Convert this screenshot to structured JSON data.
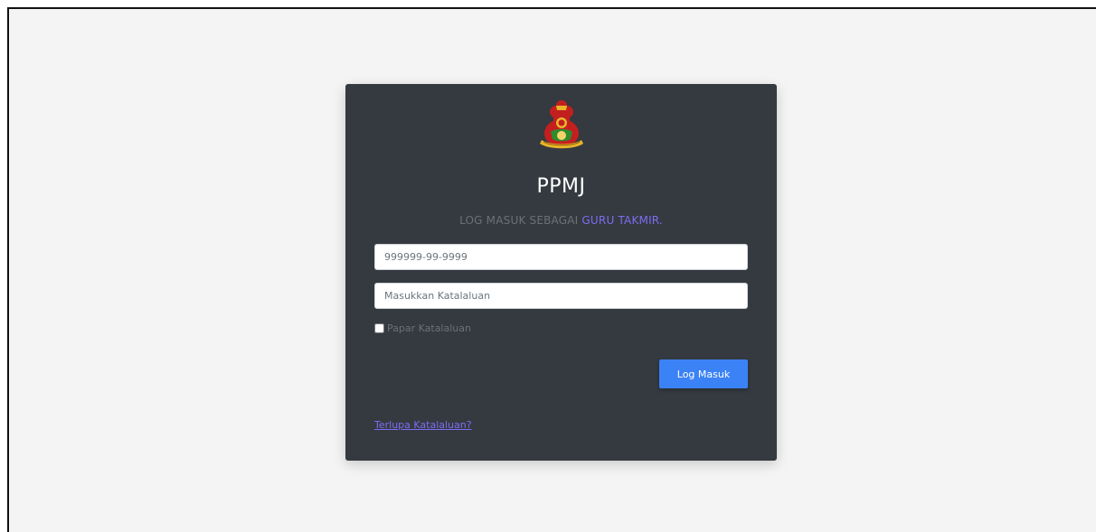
{
  "header": {
    "logo_icon": "crest-emblem-icon",
    "title": "PPMJ",
    "subtitle_prefix": "LOG MASUK SEBAGAI ",
    "subtitle_role": "GURU TAKMIR."
  },
  "form": {
    "ic_placeholder": "999999-99-9999",
    "password_placeholder": "Masukkan Katalaluan",
    "show_password_label": "Papar Katalaluan",
    "show_password_checked": false,
    "login_button": "Log Masuk",
    "forgot_link": "Terlupa Katalaluan?"
  },
  "colors": {
    "background": "#f4f4f4",
    "card": "#343a40",
    "accent": "#7b6ef2",
    "button": "#3b82f6"
  }
}
